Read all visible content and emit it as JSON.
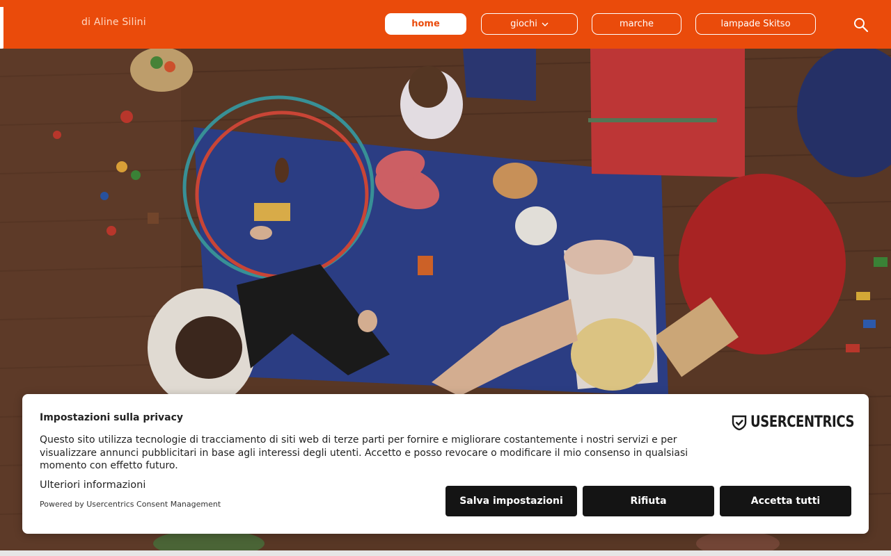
{
  "header": {
    "tagline": "di Aline Silini",
    "brand_color": "#ea4b0b",
    "nav": [
      {
        "label": "home",
        "active": true
      },
      {
        "label": "giochi",
        "has_dropdown": true
      },
      {
        "label": "marche"
      },
      {
        "label": "lampade Skitso"
      }
    ],
    "search_icon": "search-icon"
  },
  "hero": {
    "description_icon": "hero-image"
  },
  "consent": {
    "title": "Impostazioni sulla privacy",
    "text": "Questo sito utilizza tecnologie di tracciamento di siti web di terze parti per fornire e migliorare costantemente i nostri servizi e per visualizzare annunci pubblicitari in base agli interessi degli utenti. Accetto e posso revocare o modificare il mio consenso in qualsiasi momento con effetto futuro.",
    "more_info": "Ulteriori informazioni",
    "powered_by": "Powered by Usercentrics Consent Management",
    "logo_text": "USERCENTRICS",
    "buttons": {
      "save": "Salva impostazioni",
      "refuse": "Rifiuta",
      "accept": "Accetta tutti"
    },
    "button_color": "#141414"
  }
}
